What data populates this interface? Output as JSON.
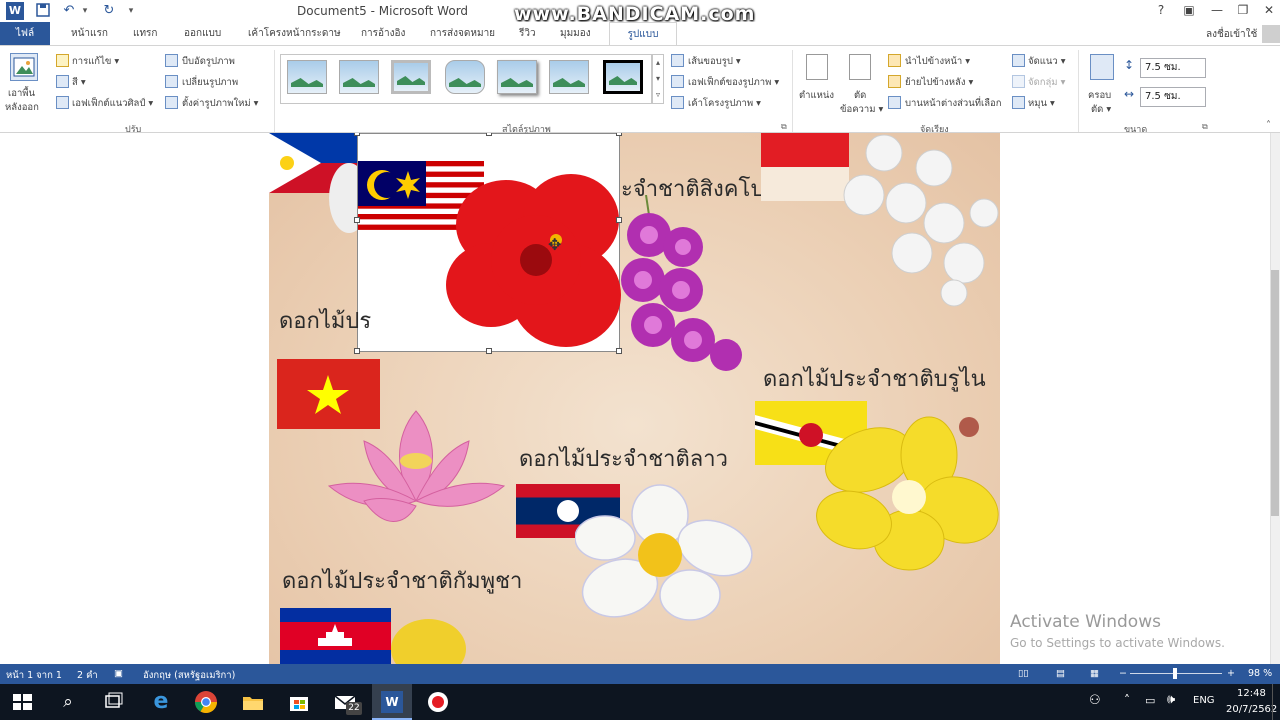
{
  "title_bar": {
    "document_title": "Document5 - Microsoft Word",
    "watermark": "www.BANDICAM.com",
    "help_label": "?",
    "ribbon_display_label": "▣",
    "minimize_label": "—",
    "restore_label": "❐",
    "close_label": "✕"
  },
  "qat": {
    "save_icon": "save-icon",
    "undo_icon": "undo-icon",
    "redo_icon": "redo-icon"
  },
  "tabs": {
    "file": "ไฟล์",
    "home": "หน้าแรก",
    "insert": "แทรก",
    "design": "ออกแบบ",
    "layout": "เค้าโครงหน้ากระดาษ",
    "references": "การอ้างอิง",
    "mailings": "การส่งจดหมาย",
    "review": "รีวิว",
    "view": "มุมมอง",
    "format": "รูปแบบ",
    "sign_in": "ลงชื่อเข้าใช้"
  },
  "ribbon": {
    "remove_background": "เอาพื้นหลังออก",
    "remove_background_line1": "เอาพื้น",
    "remove_background_line2": "หลังออก",
    "corrections": "การแก้ไข ▾",
    "color": "สี ▾",
    "artistic_effects": "เอฟเฟ็กต์แนวศิลป์ ▾",
    "compress_pictures": "บีบอัดรูปภาพ",
    "change_picture": "เปลี่ยนรูปภาพ",
    "reset_picture": "ตั้งค่ารูปภาพใหม่ ▾",
    "group_adjust": "ปรับ",
    "group_picture_styles": "สไตล์รูปภาพ",
    "picture_border": "เส้นขอบรูป ▾",
    "picture_effects": "เอฟเฟ็กต์ของรูปภาพ ▾",
    "picture_layout": "เค้าโครงรูปภาพ ▾",
    "position": "ตำแหน่ง",
    "wrap_text_line1": "ตัด",
    "wrap_text_line2": "ข้อความ ▾",
    "bring_forward": "นำไปข้างหน้า ▾",
    "send_backward": "ย้ายไปข้างหลัง ▾",
    "selection_pane": "บานหน้าต่างส่วนที่เลือก",
    "align": "จัดแนว ▾",
    "group": "จัดกลุ่ม ▾",
    "rotate": "หมุน ▾",
    "group_arrange": "จัดเรียง",
    "crop_line1": "ครอบ",
    "crop_line2": "ตัด ▾",
    "height_value": "7.5 ซม.",
    "width_value": "7.5 ซม.",
    "group_size": "ขนาด"
  },
  "document": {
    "label_singapore": "ะจำชาติสิงคโปร์",
    "label_philippines_partial": "ดอกไม้ปร",
    "label_brunei": "ดอกไม้ประจำชาติบรูไน",
    "label_laos": "ดอกไม้ประจำชาติลาว",
    "label_cambodia": "ดอกไม้ประจำชาติกัมพูชา"
  },
  "activation": {
    "line1": "Activate Windows",
    "line2": "Go to Settings to activate Windows."
  },
  "status_bar": {
    "page": "หน้า 1 จาก 1",
    "words": "2 คำ",
    "language": "อังกฤษ (สหรัฐอเมริกา)",
    "zoom_minus": "−",
    "zoom_plus": "+",
    "zoom": "98 %",
    "zoom_level": 0.98
  },
  "taskbar": {
    "mail_badge": "22",
    "language": "ENG",
    "time": "12:48",
    "date": "20/7/2562"
  },
  "colors": {
    "word_blue": "#2b579a",
    "taskbar": "#0d1520",
    "page_bg": "#ebcfb4"
  }
}
